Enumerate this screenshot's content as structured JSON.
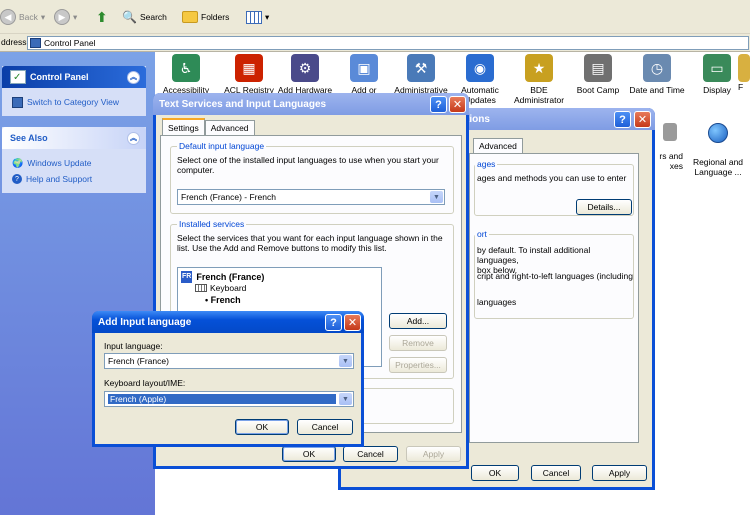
{
  "toolbar": {
    "back_label": "Back",
    "search_label": "Search",
    "folders_label": "Folders"
  },
  "address": {
    "label": "ddress",
    "value": "Control Panel"
  },
  "task_pane": {
    "control_panel_title": "Control Panel",
    "switch_view_label": "Switch to Category View",
    "see_also_title": "See Also",
    "see_also_items": [
      "Windows Update",
      "Help and Support"
    ]
  },
  "icons": [
    {
      "label": "Accessibility",
      "color": "#2e8b57"
    },
    {
      "label": "ACL Registry",
      "color": "#cc2200"
    },
    {
      "label": "Add Hardware",
      "color": "#4a4a8a"
    },
    {
      "label": "Add or",
      "color": "#5a8ad8"
    },
    {
      "label": "Administrative",
      "color": "#4a7ab8"
    },
    {
      "label": "Automatic\nUpdates",
      "color": "#2a6cd0"
    },
    {
      "label": "BDE\nAdministrator",
      "color": "#c8a020"
    },
    {
      "label": "Boot Camp",
      "color": "#707070"
    },
    {
      "label": "Date and Time",
      "color": "#6a8ab0"
    },
    {
      "label": "Display",
      "color": "#3a8a5a"
    },
    {
      "label": "F",
      "color": "#d8b040"
    }
  ],
  "partial_icons": [
    {
      "label": "rs and\nxes"
    },
    {
      "label": "Regional and\nLanguage ..."
    }
  ],
  "regional_window": {
    "title": "tions",
    "tab_advanced": "Advanced",
    "group1_label": "ages",
    "group1_text": "ages and methods you can use to enter",
    "details_button": "Details...",
    "group2_label": "ort",
    "group2_text1": "by default. To install additional languages,\nbox below.",
    "group2_text2": "cript and right-to-left languages (including",
    "group2_text3": "languages",
    "ok": "OK",
    "cancel": "Cancel",
    "apply": "Apply"
  },
  "text_services": {
    "title": "Text Services and Input Languages",
    "tab_settings": "Settings",
    "tab_advanced": "Advanced",
    "default_group_label": "Default input language",
    "default_text": "Select one of the installed input languages to use when you start your computer.",
    "default_value": "French (France) - French",
    "installed_group_label": "Installed services",
    "installed_text": "Select the services that you want for each input language shown in the list. Use the Add and Remove buttons to modify this list.",
    "tree_language": "French (France)",
    "tree_badge": "FR",
    "tree_category": "Keyboard",
    "tree_item": "French",
    "add_button": "Add...",
    "remove_button": "Remove",
    "properties_button": "Properties...",
    "ok": "OK",
    "cancel": "Cancel",
    "apply": "Apply"
  },
  "add_input": {
    "title": "Add Input language",
    "input_language_label": "Input language:",
    "input_language_value": "French (France)",
    "keyboard_label": "Keyboard layout/IME:",
    "keyboard_value": "French (Apple)",
    "ok": "OK",
    "cancel": "Cancel"
  }
}
